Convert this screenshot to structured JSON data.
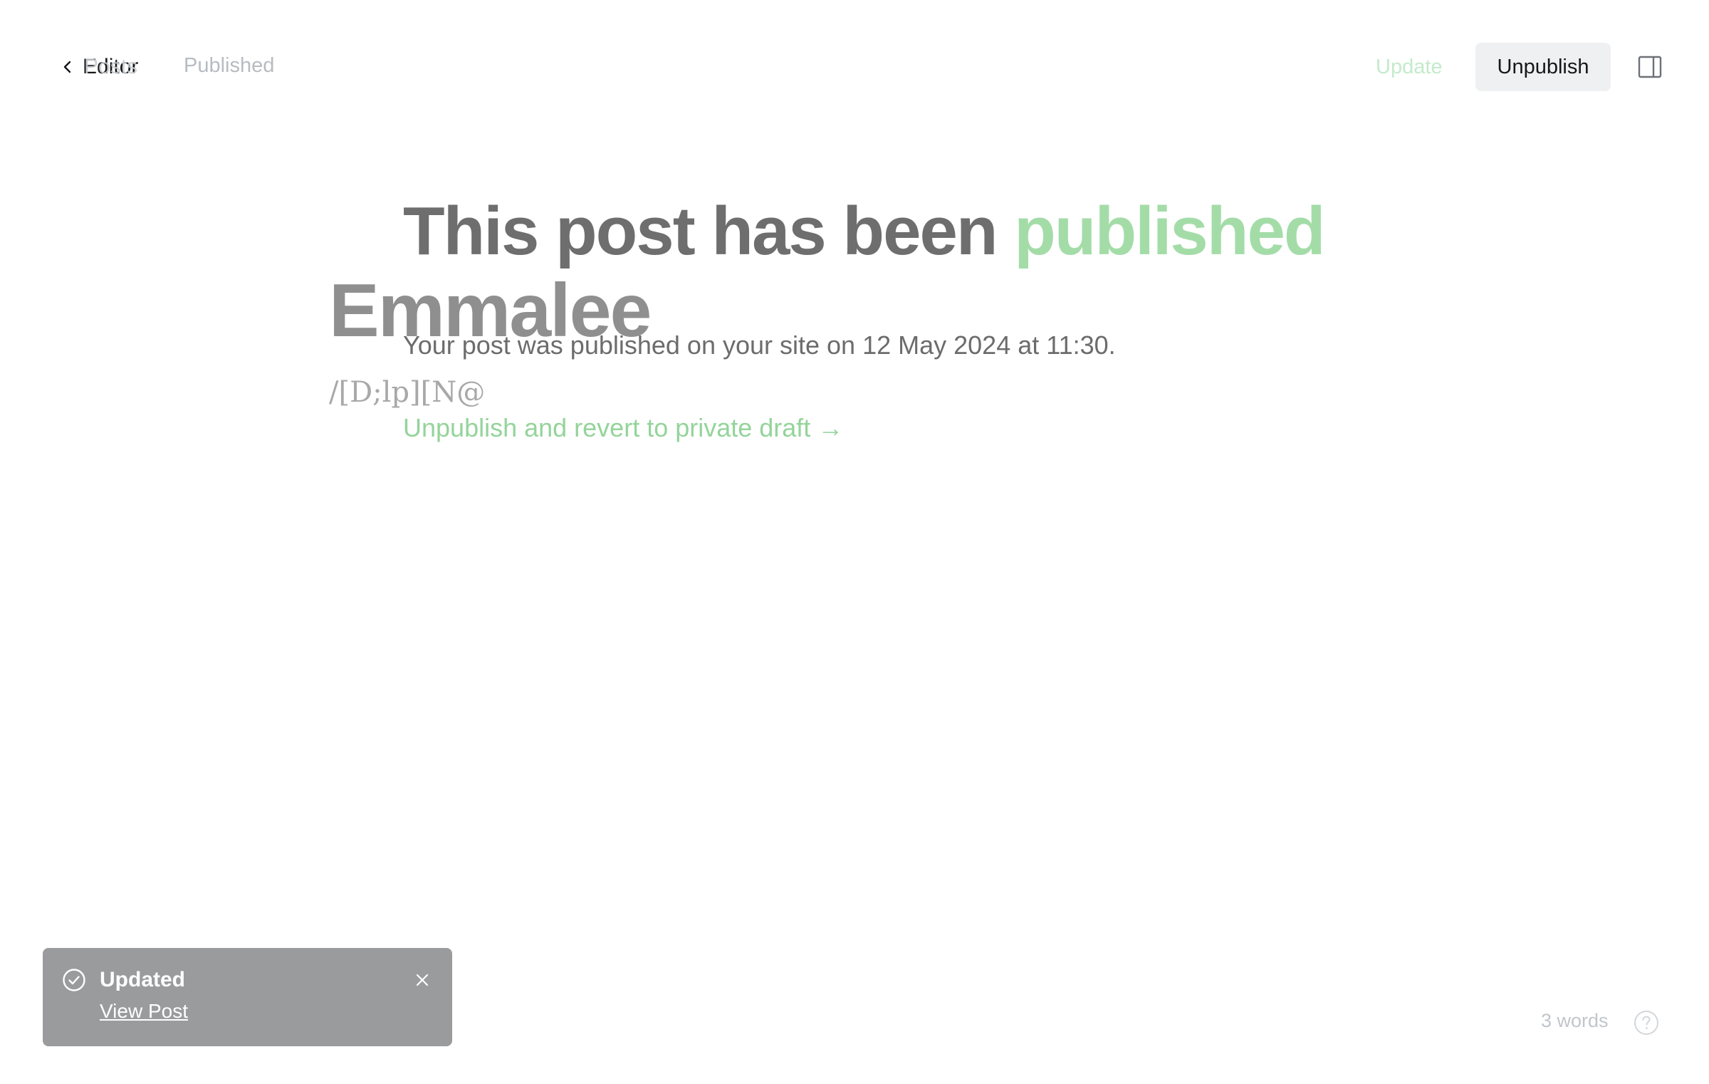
{
  "header": {
    "back_label": "Editor",
    "back_label_ghost": "Posts",
    "status": "Published",
    "update_label": "Update",
    "unpublish_label": "Unpublish"
  },
  "editor": {
    "title": "Emmalee",
    "body": "/[D;lp][N@"
  },
  "confirmation": {
    "heading_prefix": "This post has been",
    "heading_accent": "published",
    "message": "Your post was published on your site on 12 May 2024 at 11:30.",
    "revert_link": "Unpublish and revert to private draft →"
  },
  "toast": {
    "title": "Updated",
    "link": "View Post"
  },
  "footer": {
    "word_count": "3 words"
  },
  "icons": {
    "back": "chevron-left-icon",
    "sidebar_toggle": "sidebar-panel-icon",
    "toast_status": "check-circle-icon",
    "toast_close": "close-icon",
    "help": "question-circle-icon"
  },
  "colors": {
    "accent_green": "#a4dca8",
    "link_green": "#94d49a",
    "toast_bg": "#9a9b9d"
  }
}
